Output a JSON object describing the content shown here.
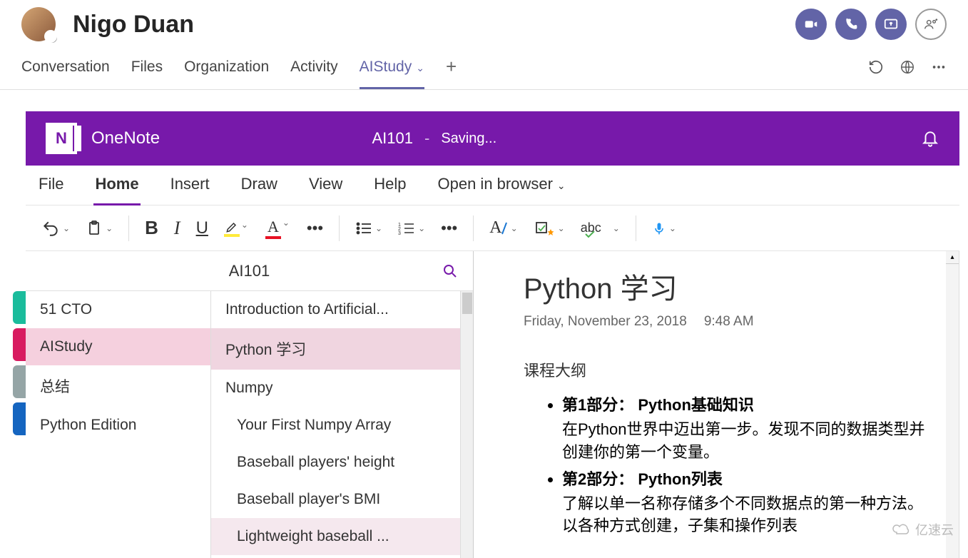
{
  "header": {
    "username": "Nigo Duan"
  },
  "tabs": {
    "items": [
      {
        "label": "Conversation"
      },
      {
        "label": "Files"
      },
      {
        "label": "Organization"
      },
      {
        "label": "Activity"
      },
      {
        "label": "AIStudy"
      }
    ]
  },
  "onenote": {
    "app": "OneNote",
    "doc": "AI101",
    "sep": "-",
    "status": "Saving..."
  },
  "ribbon": {
    "items": [
      {
        "label": "File"
      },
      {
        "label": "Home"
      },
      {
        "label": "Insert"
      },
      {
        "label": "Draw"
      },
      {
        "label": "View"
      },
      {
        "label": "Help"
      },
      {
        "label": "Open in browser"
      }
    ]
  },
  "nav": {
    "title": "AI101",
    "sections": [
      {
        "label": "51 CTO"
      },
      {
        "label": "AIStudy"
      },
      {
        "label": "总结"
      },
      {
        "label": "Python Edition"
      }
    ],
    "section_colors": [
      "#1abc9c",
      "#d81b60",
      "#95a5a6",
      "#1565c0"
    ],
    "pages": [
      {
        "label": "Introduction to Artificial..."
      },
      {
        "label": "Python 学习"
      },
      {
        "label": "Numpy"
      },
      {
        "label": "Your First Numpy Array"
      },
      {
        "label": "Baseball players' height"
      },
      {
        "label": "Baseball player's BMI"
      },
      {
        "label": "Lightweight baseball ..."
      }
    ]
  },
  "page": {
    "title": "Python 学习",
    "date": "Friday, November 23, 2018",
    "time": "9:48 AM",
    "subhead": "课程大纲",
    "items": [
      {
        "title": "第1部分： Python基础知识",
        "desc": "在Python世界中迈出第一步。发现不同的数据类型并创建你的第一个变量。"
      },
      {
        "title": "第2部分： Python列表",
        "desc": "了解以单一名称存储多个不同数据点的第一种方法。以各种方式创建，子集和操作列表"
      }
    ]
  },
  "watermark": "亿速云"
}
